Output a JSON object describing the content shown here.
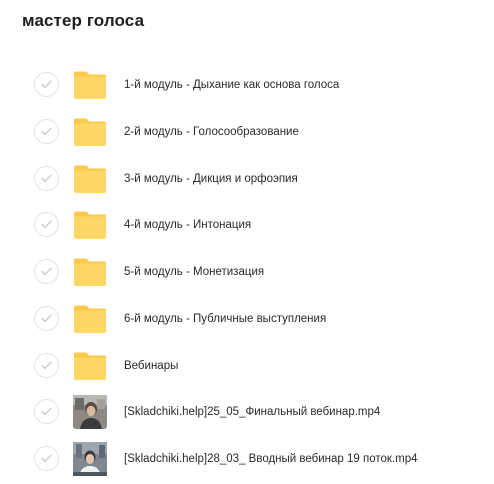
{
  "page": {
    "title": "мастер голоса"
  },
  "colors": {
    "folder_fill": "#ffd766",
    "folder_tab": "#fcc94a",
    "check_border": "#e3e3e3",
    "check_mark": "#c8c8c8",
    "text": "#2a2a2a"
  },
  "items": [
    {
      "type": "folder",
      "icon": "folder-icon",
      "name": "1-й модуль - Дыхание как основа голоса"
    },
    {
      "type": "folder",
      "icon": "folder-icon",
      "name": "2-й модуль - Голосообразование"
    },
    {
      "type": "folder",
      "icon": "folder-icon",
      "name": "3-й модуль - Дикция и орфоэпия"
    },
    {
      "type": "folder",
      "icon": "folder-icon",
      "name": "4-й модуль - Интонация"
    },
    {
      "type": "folder",
      "icon": "folder-icon",
      "name": "5-й модуль - Монетизация"
    },
    {
      "type": "folder",
      "icon": "folder-icon",
      "name": "6-й модуль - Публичные выступления"
    },
    {
      "type": "folder",
      "icon": "folder-icon",
      "name": "Вебинары"
    },
    {
      "type": "video",
      "icon": "video-thumbnail",
      "name": "[Skladchiki.help]25_05_Финальный вебинар.mp4"
    },
    {
      "type": "video",
      "icon": "video-thumbnail",
      "name": "[Skladchiki.help]28_03_ Вводный вебинар 19 поток.mp4"
    }
  ]
}
